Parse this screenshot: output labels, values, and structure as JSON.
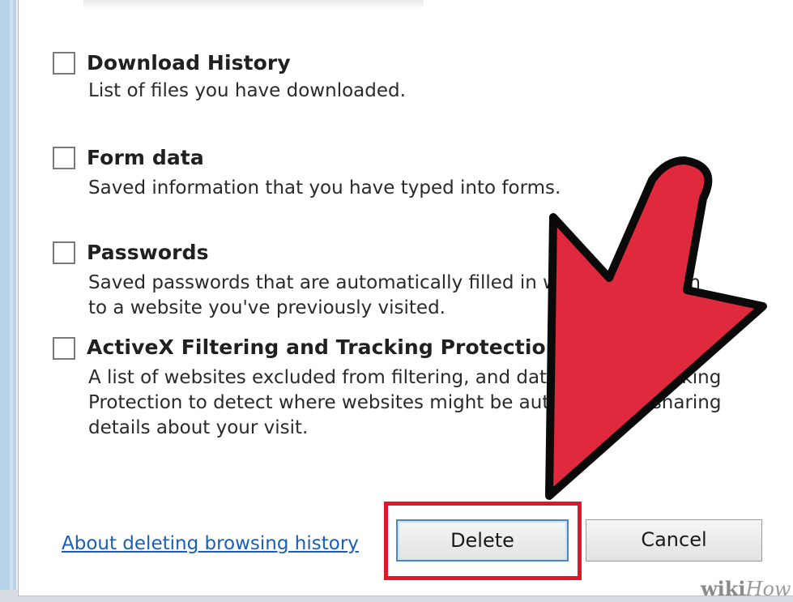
{
  "options": [
    {
      "title": "Download History",
      "desc": [
        "List of files you have downloaded."
      ]
    },
    {
      "title": "Form data",
      "desc": [
        "Saved information that you have typed into forms."
      ]
    },
    {
      "title": "Passwords",
      "desc": [
        "Saved passwords that are automatically filled in when you sign in",
        "to a website you've previously visited."
      ]
    },
    {
      "title": "ActiveX Filtering and Tracking Protection data",
      "desc": [
        "A list of websites excluded from filtering, and data used by Tracking",
        "Protection to detect where websites might be automatically sharing",
        "details about your visit."
      ]
    }
  ],
  "footer": {
    "link": "About deleting browsing history",
    "delete_label": "Delete",
    "cancel_label": "Cancel"
  },
  "watermark": {
    "wiki": "wiki",
    "how": "How"
  },
  "colors": {
    "arrow": "#e0293c",
    "highlight": "#e0162b",
    "link": "#1a5fb4"
  }
}
